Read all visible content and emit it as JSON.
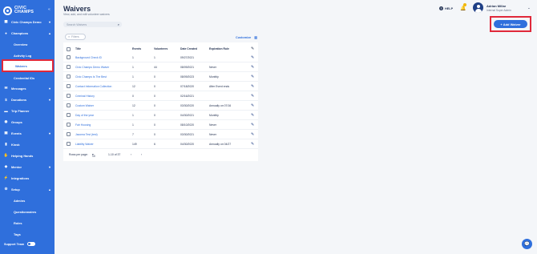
{
  "brand": {
    "line1": "CIVIC",
    "line2": "CHAMPS"
  },
  "sidebar": {
    "items": [
      {
        "label": "Civic Champs Demo",
        "icon": "building-icon",
        "chevron": "▾"
      },
      {
        "label": "Champions",
        "icon": "person-icon",
        "chevron": "▴"
      },
      {
        "label": "Overview",
        "icon": "",
        "chevron": ""
      },
      {
        "label": "Activity Log",
        "icon": "",
        "chevron": ""
      },
      {
        "label": "Waivers",
        "icon": "",
        "chevron": ""
      },
      {
        "label": "Credential IDs",
        "icon": "",
        "chevron": ""
      },
      {
        "label": "Messages",
        "icon": "mail-icon",
        "chevron": "▾"
      },
      {
        "label": "Donations",
        "icon": "dollar-icon",
        "chevron": "▾"
      },
      {
        "label": "Trip Planner",
        "icon": "car-icon",
        "chevron": ""
      },
      {
        "label": "Groups",
        "icon": "group-icon",
        "chevron": ""
      },
      {
        "label": "Events",
        "icon": "calendar-icon",
        "chevron": "▾"
      },
      {
        "label": "Kiosk",
        "icon": "kiosk-icon",
        "chevron": ""
      },
      {
        "label": "Helping Hands",
        "icon": "hands-icon",
        "chevron": ""
      },
      {
        "label": "Mentor",
        "icon": "mentor-icon",
        "chevron": "▾"
      },
      {
        "label": "Integrations",
        "icon": "plug-icon",
        "chevron": ""
      },
      {
        "label": "Setup",
        "icon": "gear-icon",
        "chevron": "▴"
      },
      {
        "label": "Admins",
        "icon": "",
        "chevron": ""
      },
      {
        "label": "Questionnaires",
        "icon": "",
        "chevron": ""
      },
      {
        "label": "Roles",
        "icon": "",
        "chevron": ""
      },
      {
        "label": "Tags",
        "icon": "",
        "chevron": ""
      }
    ],
    "active_index": 4,
    "support": "Support Team"
  },
  "header": {
    "title": "Waivers",
    "subtitle": "View, add, and edit volunteer waivers",
    "help": "HELP",
    "user_name": "Adrian Millar",
    "user_role": "Internal Super Admin"
  },
  "toolbar": {
    "add_label": "+ Add Waiver",
    "search_placeholder": "Search Waivers",
    "filter_label": "Filters",
    "customize_label": "Customize"
  },
  "table": {
    "columns": [
      "Title",
      "Events",
      "Volunteers",
      "Date Created",
      "Expiration Rule"
    ],
    "rows": [
      {
        "title": "Background Check ID",
        "events": "1",
        "volunteers": "1",
        "date": "09/27/2021",
        "rule": ""
      },
      {
        "title": "Civic Champs Demo Waiver",
        "events": "1",
        "volunteers": "44",
        "date": "08/09/2021",
        "rule": "Never"
      },
      {
        "title": "Civic Champs Is The Best",
        "events": "1",
        "volunteers": "0",
        "date": "08/09/2023",
        "rule": "Monthly"
      },
      {
        "title": "Contact Information Collection",
        "events": "12",
        "volunteers": "0",
        "date": "07/18/2020",
        "rule": "After Event ends"
      },
      {
        "title": "Criminal History",
        "events": "0",
        "volunteers": "0",
        "date": "02/16/2021",
        "rule": ""
      },
      {
        "title": "Custom Waiver",
        "events": "12",
        "volunteers": "0",
        "date": "03/30/2020",
        "rule": "Annually on 07/16"
      },
      {
        "title": "Day of the year",
        "events": "1",
        "volunteers": "0",
        "date": "04/30/2021",
        "rule": "Monthly"
      },
      {
        "title": "Fair Housing",
        "events": "1",
        "volunteers": "0",
        "date": "08/10/2020",
        "rule": "Never"
      },
      {
        "title": "Jacoma Test (test)",
        "events": "7",
        "volunteers": "0",
        "date": "03/30/2021",
        "rule": "Never"
      },
      {
        "title": "Liability Waiver",
        "events": "149",
        "volunteers": "6",
        "date": "04/30/2020",
        "rule": "Annually on 04/27"
      }
    ]
  },
  "pager": {
    "rows_label": "Rows per page:",
    "rows_value": "10",
    "range": "1-10 of 37"
  },
  "colors": {
    "accent": "#2f6fdc",
    "highlight": "#e0283a"
  }
}
